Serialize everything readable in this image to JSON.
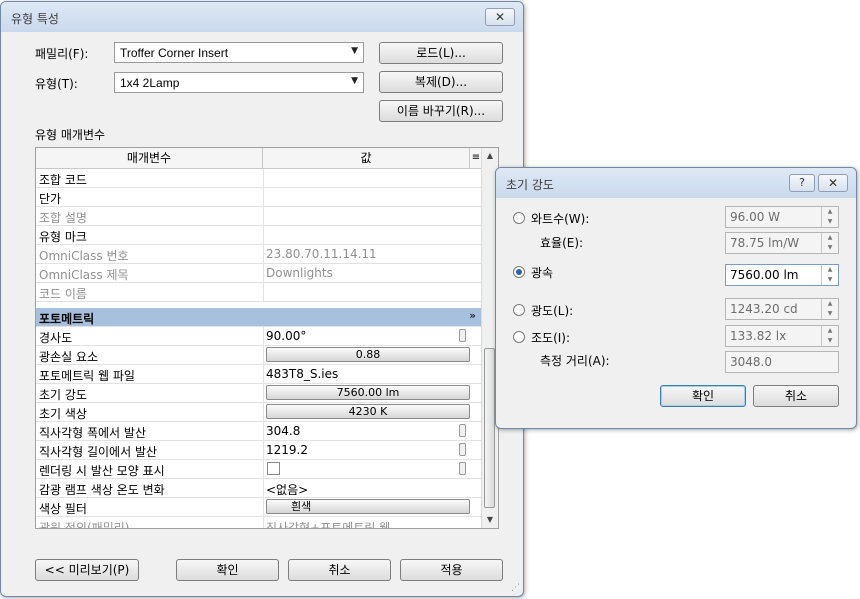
{
  "type_props": {
    "title": "유형 특성",
    "family_label": "패밀리(F):",
    "family_value": "Troffer Corner Insert",
    "type_label": "유형(T):",
    "type_value": "1x4 2Lamp",
    "load_btn": "로드(L)...",
    "duplicate_btn": "복제(D)...",
    "rename_btn": "이름 바꾸기(R)...",
    "section_label": "유형 매개변수",
    "col_param": "매개변수",
    "col_value": "값",
    "rows": [
      {
        "name": "조합 코드",
        "value": ""
      },
      {
        "name": "단가",
        "value": ""
      },
      {
        "name": "조합 설명",
        "value": ""
      },
      {
        "name": "유형 마크",
        "value": ""
      },
      {
        "name": "OmniClass 번호",
        "value": "23.80.70.11.14.11"
      },
      {
        "name": "OmniClass 제목",
        "value": "Downlights"
      },
      {
        "name": "코드 이름",
        "value": ""
      },
      {
        "name": "포토메트릭",
        "value": ""
      },
      {
        "name": "경사도",
        "value": "90.00°"
      },
      {
        "name": "광손실 요소",
        "value": "0.88"
      },
      {
        "name": "포토메트릭 웹 파일",
        "value": "483T8_S.ies"
      },
      {
        "name": "초기 강도",
        "value": "7560.00 lm"
      },
      {
        "name": "초기 색상",
        "value": "4230 K"
      },
      {
        "name": "직사각형 폭에서 발산",
        "value": "304.8"
      },
      {
        "name": "직사각형 길이에서 발산",
        "value": "1219.2"
      },
      {
        "name": "렌더링 시 발산 모양 표시",
        "value": ""
      },
      {
        "name": "감광 램프 색상 온도 변화",
        "value": "<없음>"
      },
      {
        "name": "색상 필터",
        "value": "흰색"
      },
      {
        "name": "광원 정의(패밀리)",
        "value": "직사각형+포토메트릭 웹"
      }
    ],
    "preview_btn": "<< 미리보기(P)",
    "ok_btn": "확인",
    "cancel_btn": "취소",
    "apply_btn": "적용"
  },
  "intensity": {
    "title": "초기 강도",
    "help_btn": "?",
    "close_btn": "✕",
    "wattage_label": "와트수(W):",
    "wattage_value": "96.00 W",
    "efficacy_label": "효율(E):",
    "efficacy_value": "78.75 lm/W",
    "flux_label": "광속",
    "flux_value": "7560.00 lm",
    "luminous_label": "광도(L):",
    "luminous_value": "1243.20 cd",
    "illum_label": "조도(I):",
    "illum_value": "133.82 lx",
    "distance_label": "측정 거리(A):",
    "distance_value": "3048.0",
    "ok_btn": "확인",
    "cancel_btn": "취소"
  }
}
